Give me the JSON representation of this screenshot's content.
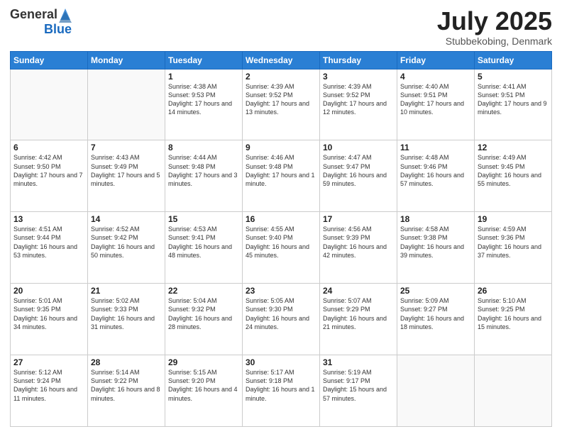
{
  "header": {
    "logo_general": "General",
    "logo_blue": "Blue",
    "month_title": "July 2025",
    "location": "Stubbekobing, Denmark"
  },
  "days_of_week": [
    "Sunday",
    "Monday",
    "Tuesday",
    "Wednesday",
    "Thursday",
    "Friday",
    "Saturday"
  ],
  "weeks": [
    [
      {
        "num": "",
        "info": ""
      },
      {
        "num": "",
        "info": ""
      },
      {
        "num": "1",
        "info": "Sunrise: 4:38 AM\nSunset: 9:53 PM\nDaylight: 17 hours and 14 minutes."
      },
      {
        "num": "2",
        "info": "Sunrise: 4:39 AM\nSunset: 9:52 PM\nDaylight: 17 hours and 13 minutes."
      },
      {
        "num": "3",
        "info": "Sunrise: 4:39 AM\nSunset: 9:52 PM\nDaylight: 17 hours and 12 minutes."
      },
      {
        "num": "4",
        "info": "Sunrise: 4:40 AM\nSunset: 9:51 PM\nDaylight: 17 hours and 10 minutes."
      },
      {
        "num": "5",
        "info": "Sunrise: 4:41 AM\nSunset: 9:51 PM\nDaylight: 17 hours and 9 minutes."
      }
    ],
    [
      {
        "num": "6",
        "info": "Sunrise: 4:42 AM\nSunset: 9:50 PM\nDaylight: 17 hours and 7 minutes."
      },
      {
        "num": "7",
        "info": "Sunrise: 4:43 AM\nSunset: 9:49 PM\nDaylight: 17 hours and 5 minutes."
      },
      {
        "num": "8",
        "info": "Sunrise: 4:44 AM\nSunset: 9:48 PM\nDaylight: 17 hours and 3 minutes."
      },
      {
        "num": "9",
        "info": "Sunrise: 4:46 AM\nSunset: 9:48 PM\nDaylight: 17 hours and 1 minute."
      },
      {
        "num": "10",
        "info": "Sunrise: 4:47 AM\nSunset: 9:47 PM\nDaylight: 16 hours and 59 minutes."
      },
      {
        "num": "11",
        "info": "Sunrise: 4:48 AM\nSunset: 9:46 PM\nDaylight: 16 hours and 57 minutes."
      },
      {
        "num": "12",
        "info": "Sunrise: 4:49 AM\nSunset: 9:45 PM\nDaylight: 16 hours and 55 minutes."
      }
    ],
    [
      {
        "num": "13",
        "info": "Sunrise: 4:51 AM\nSunset: 9:44 PM\nDaylight: 16 hours and 53 minutes."
      },
      {
        "num": "14",
        "info": "Sunrise: 4:52 AM\nSunset: 9:42 PM\nDaylight: 16 hours and 50 minutes."
      },
      {
        "num": "15",
        "info": "Sunrise: 4:53 AM\nSunset: 9:41 PM\nDaylight: 16 hours and 48 minutes."
      },
      {
        "num": "16",
        "info": "Sunrise: 4:55 AM\nSunset: 9:40 PM\nDaylight: 16 hours and 45 minutes."
      },
      {
        "num": "17",
        "info": "Sunrise: 4:56 AM\nSunset: 9:39 PM\nDaylight: 16 hours and 42 minutes."
      },
      {
        "num": "18",
        "info": "Sunrise: 4:58 AM\nSunset: 9:38 PM\nDaylight: 16 hours and 39 minutes."
      },
      {
        "num": "19",
        "info": "Sunrise: 4:59 AM\nSunset: 9:36 PM\nDaylight: 16 hours and 37 minutes."
      }
    ],
    [
      {
        "num": "20",
        "info": "Sunrise: 5:01 AM\nSunset: 9:35 PM\nDaylight: 16 hours and 34 minutes."
      },
      {
        "num": "21",
        "info": "Sunrise: 5:02 AM\nSunset: 9:33 PM\nDaylight: 16 hours and 31 minutes."
      },
      {
        "num": "22",
        "info": "Sunrise: 5:04 AM\nSunset: 9:32 PM\nDaylight: 16 hours and 28 minutes."
      },
      {
        "num": "23",
        "info": "Sunrise: 5:05 AM\nSunset: 9:30 PM\nDaylight: 16 hours and 24 minutes."
      },
      {
        "num": "24",
        "info": "Sunrise: 5:07 AM\nSunset: 9:29 PM\nDaylight: 16 hours and 21 minutes."
      },
      {
        "num": "25",
        "info": "Sunrise: 5:09 AM\nSunset: 9:27 PM\nDaylight: 16 hours and 18 minutes."
      },
      {
        "num": "26",
        "info": "Sunrise: 5:10 AM\nSunset: 9:25 PM\nDaylight: 16 hours and 15 minutes."
      }
    ],
    [
      {
        "num": "27",
        "info": "Sunrise: 5:12 AM\nSunset: 9:24 PM\nDaylight: 16 hours and 11 minutes."
      },
      {
        "num": "28",
        "info": "Sunrise: 5:14 AM\nSunset: 9:22 PM\nDaylight: 16 hours and 8 minutes."
      },
      {
        "num": "29",
        "info": "Sunrise: 5:15 AM\nSunset: 9:20 PM\nDaylight: 16 hours and 4 minutes."
      },
      {
        "num": "30",
        "info": "Sunrise: 5:17 AM\nSunset: 9:18 PM\nDaylight: 16 hours and 1 minute."
      },
      {
        "num": "31",
        "info": "Sunrise: 5:19 AM\nSunset: 9:17 PM\nDaylight: 15 hours and 57 minutes."
      },
      {
        "num": "",
        "info": ""
      },
      {
        "num": "",
        "info": ""
      }
    ]
  ]
}
